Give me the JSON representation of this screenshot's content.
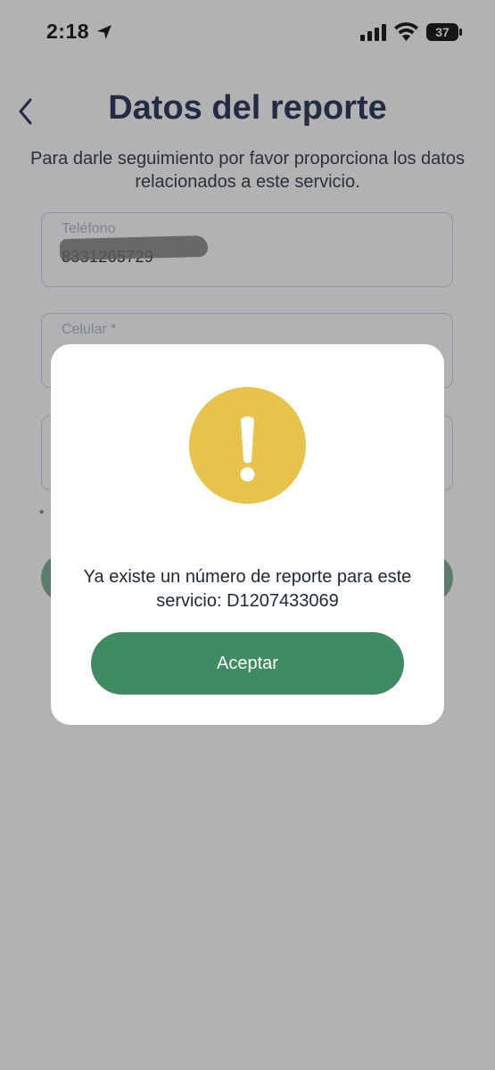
{
  "status_bar": {
    "time": "2:18",
    "battery": "37"
  },
  "header": {
    "title": "Datos del reporte",
    "subtitle": "Para darle seguimiento por favor proporciona los datos relacionados a este servicio."
  },
  "form": {
    "phone": {
      "label": "Teléfono",
      "value": "8331265729"
    },
    "cell": {
      "label": "Celular *"
    },
    "required_note": "*"
  },
  "dialog": {
    "message": "Ya existe un número de reporte para este servicio: D1207433069",
    "accept_label": "Aceptar",
    "icon": "warning-icon"
  },
  "colors": {
    "warning": "#e8c34b",
    "primary": "#3f8b63",
    "title": "#19213d"
  }
}
